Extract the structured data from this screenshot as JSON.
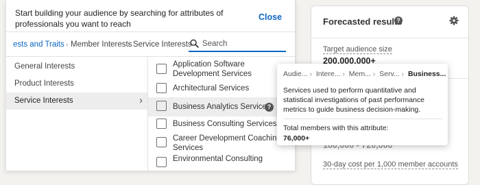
{
  "picker": {
    "instruction": "Start building your audience by searching for attributes of professionals you want to reach",
    "close_label": "Close",
    "breadcrumb": [
      "ests and Traits",
      "Member Interests",
      "Service Interests"
    ],
    "search": {
      "placeholder": "Search",
      "value": ""
    },
    "categories": [
      {
        "label": "General Interests"
      },
      {
        "label": "Product Interests"
      },
      {
        "label": "Service Interests",
        "chevron": "›"
      }
    ],
    "options": [
      {
        "label": "Application Software Development Services"
      },
      {
        "label": "Architectural Services"
      },
      {
        "label": "Business Analytics Services"
      },
      {
        "label": "Business Consulting Services"
      },
      {
        "label": "Career Development Coaching Services"
      },
      {
        "label": "Environmental Consulting"
      }
    ],
    "help_glyph": "?"
  },
  "tooltip": {
    "crumbs": [
      "Audie...",
      "Intere...",
      "Mem...",
      "Serv..."
    ],
    "current": "Business...",
    "description": "Services used to perform quantitative and statistical investigations of past performance metrics to guide business decision-making.",
    "total_label": "Total members with this attribute:",
    "total_value": "76,000+"
  },
  "forecast": {
    "title": "Forecasted results",
    "help_glyph": "?",
    "target_label": "Target audience size",
    "target_value": "200,000,000+",
    "partial_value": "180,000 - 720,000",
    "cost_label": "30-day cost per 1,000 member accounts"
  }
}
